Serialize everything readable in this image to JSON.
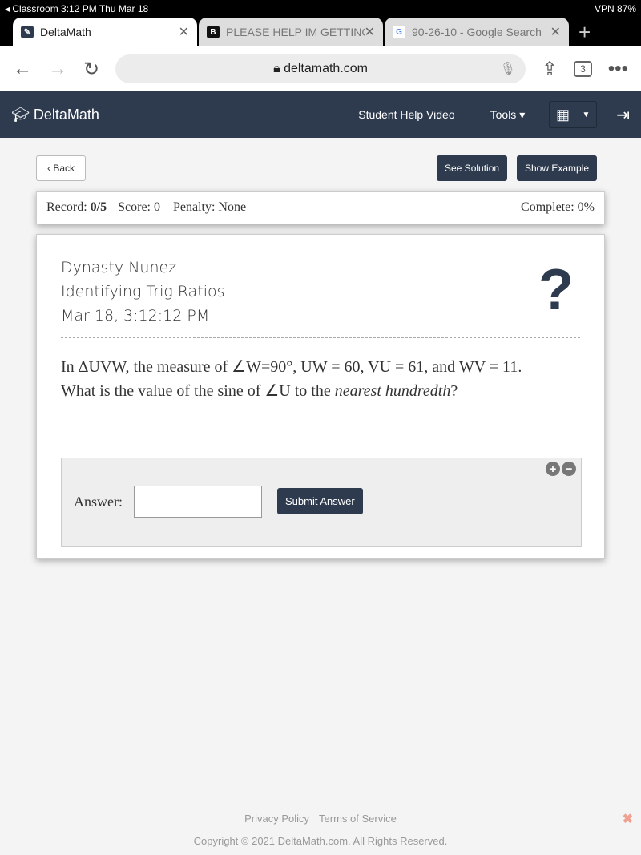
{
  "status": {
    "left": "◂ Classroom   3:12 PM   Thu Mar 18",
    "right": "VPN  87%"
  },
  "tabs": [
    {
      "label": "DeltaMath",
      "icon": "D"
    },
    {
      "label": "PLEASE HELP IM GETTING",
      "icon": "B"
    },
    {
      "label": "90-26-10 - Google Search",
      "icon": "G"
    }
  ],
  "url": "deltamath.com",
  "tab_count": "3",
  "header": {
    "logo": "DeltaMath",
    "help": "Student Help Video",
    "tools": "Tools ▾"
  },
  "buttons": {
    "back": "Back",
    "solution": "See Solution",
    "example": "Show Example",
    "submit": "Submit Answer"
  },
  "record": {
    "record_label": "Record:",
    "record": "0/5",
    "score": "Score: 0",
    "penalty": "Penalty: None",
    "complete": "Complete: 0%"
  },
  "info": {
    "name": "Dynasty Nunez",
    "topic": "Identifying Trig Ratios",
    "date": "Mar 18, 3:12:12 PM"
  },
  "problem": {
    "line1": "In ΔUVW, the measure of ∠W=90°, UW = 60, VU = 61, and WV = 11.",
    "line2_a": "What is the value of the sine of ∠U to the ",
    "line2_em": "nearest hundredth",
    "line2_b": "?"
  },
  "answer": {
    "label": "Answer:",
    "value": ""
  },
  "footer": {
    "privacy": "Privacy Policy",
    "terms": "Terms of Service",
    "copyright": "Copyright © 2021 DeltaMath.com. All Rights Reserved."
  }
}
